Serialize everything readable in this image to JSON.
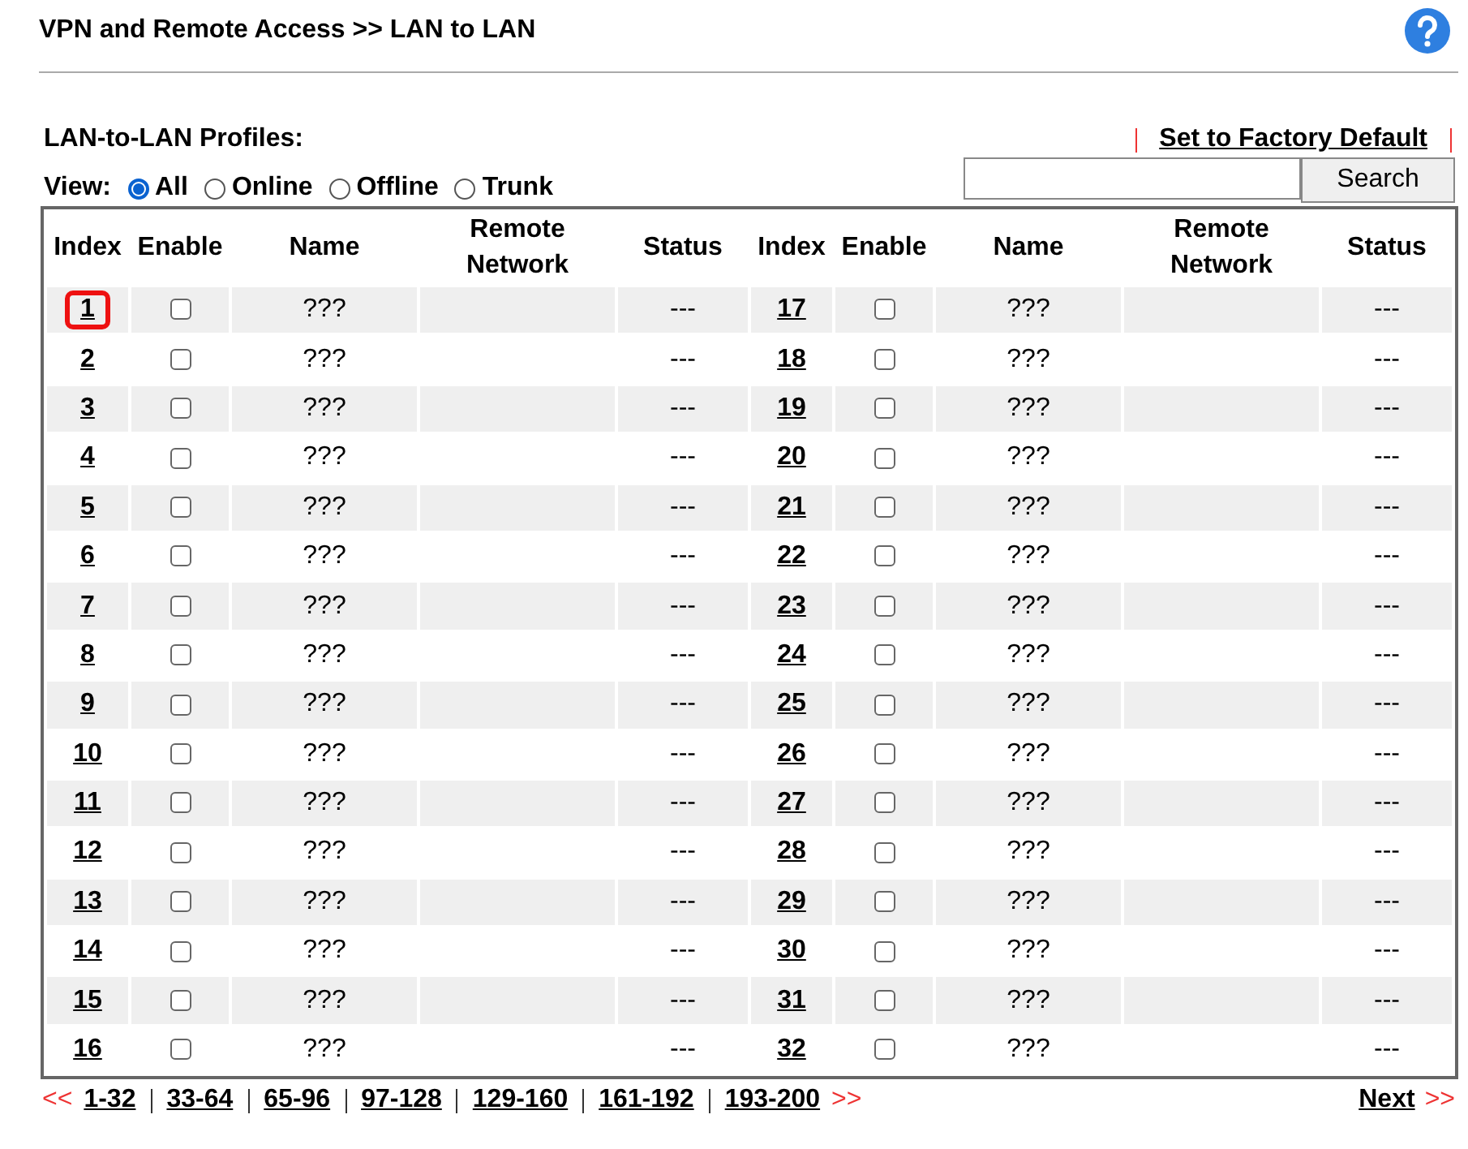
{
  "title": "VPN and Remote Access >> LAN to LAN",
  "section_title": "LAN-to-LAN Profiles:",
  "factory_default_link": "Set to Factory Default",
  "view": {
    "label": "View:",
    "options": [
      {
        "label": "All",
        "selected": true
      },
      {
        "label": "Online",
        "selected": false
      },
      {
        "label": "Offline",
        "selected": false
      },
      {
        "label": "Trunk",
        "selected": false
      }
    ]
  },
  "search": {
    "button": "Search"
  },
  "columns": [
    "Index",
    "Enable",
    "Name",
    "Remote Network",
    "Status",
    "Index",
    "Enable",
    "Name",
    "Remote Network",
    "Status"
  ],
  "profiles": [
    {
      "index": "1",
      "enabled": false,
      "name": "???",
      "status": "---",
      "highlighted": true
    },
    {
      "index": "2",
      "enabled": false,
      "name": "???",
      "status": "---",
      "highlighted": false
    },
    {
      "index": "3",
      "enabled": false,
      "name": "???",
      "status": "---",
      "highlighted": false
    },
    {
      "index": "4",
      "enabled": false,
      "name": "???",
      "status": "---",
      "highlighted": false
    },
    {
      "index": "5",
      "enabled": false,
      "name": "???",
      "status": "---",
      "highlighted": false
    },
    {
      "index": "6",
      "enabled": false,
      "name": "???",
      "status": "---",
      "highlighted": false
    },
    {
      "index": "7",
      "enabled": false,
      "name": "???",
      "status": "---",
      "highlighted": false
    },
    {
      "index": "8",
      "enabled": false,
      "name": "???",
      "status": "---",
      "highlighted": false
    },
    {
      "index": "9",
      "enabled": false,
      "name": "???",
      "status": "---",
      "highlighted": false
    },
    {
      "index": "10",
      "enabled": false,
      "name": "???",
      "status": "---",
      "highlighted": false
    },
    {
      "index": "11",
      "enabled": false,
      "name": "???",
      "status": "---",
      "highlighted": false
    },
    {
      "index": "12",
      "enabled": false,
      "name": "???",
      "status": "---",
      "highlighted": false
    },
    {
      "index": "13",
      "enabled": false,
      "name": "???",
      "status": "---",
      "highlighted": false
    },
    {
      "index": "14",
      "enabled": false,
      "name": "???",
      "status": "---",
      "highlighted": false
    },
    {
      "index": "15",
      "enabled": false,
      "name": "???",
      "status": "---",
      "highlighted": false
    },
    {
      "index": "16",
      "enabled": false,
      "name": "???",
      "status": "---",
      "highlighted": false
    },
    {
      "index": "17",
      "enabled": false,
      "name": "???",
      "status": "---",
      "highlighted": false
    },
    {
      "index": "18",
      "enabled": false,
      "name": "???",
      "status": "---",
      "highlighted": false
    },
    {
      "index": "19",
      "enabled": false,
      "name": "???",
      "status": "---",
      "highlighted": false
    },
    {
      "index": "20",
      "enabled": false,
      "name": "???",
      "status": "---",
      "highlighted": false
    },
    {
      "index": "21",
      "enabled": false,
      "name": "???",
      "status": "---",
      "highlighted": false
    },
    {
      "index": "22",
      "enabled": false,
      "name": "???",
      "status": "---",
      "highlighted": false
    },
    {
      "index": "23",
      "enabled": false,
      "name": "???",
      "status": "---",
      "highlighted": false
    },
    {
      "index": "24",
      "enabled": false,
      "name": "???",
      "status": "---",
      "highlighted": false
    },
    {
      "index": "25",
      "enabled": false,
      "name": "???",
      "status": "---",
      "highlighted": false
    },
    {
      "index": "26",
      "enabled": false,
      "name": "???",
      "status": "---",
      "highlighted": false
    },
    {
      "index": "27",
      "enabled": false,
      "name": "???",
      "status": "---",
      "highlighted": false
    },
    {
      "index": "28",
      "enabled": false,
      "name": "???",
      "status": "---",
      "highlighted": false
    },
    {
      "index": "29",
      "enabled": false,
      "name": "???",
      "status": "---",
      "highlighted": false
    },
    {
      "index": "30",
      "enabled": false,
      "name": "???",
      "status": "---",
      "highlighted": false
    },
    {
      "index": "31",
      "enabled": false,
      "name": "???",
      "status": "---",
      "highlighted": false
    },
    {
      "index": "32",
      "enabled": false,
      "name": "???",
      "status": "---",
      "highlighted": false
    }
  ],
  "pagination": {
    "prev": "<<",
    "pages": [
      "1-32",
      "33-64",
      "65-96",
      "97-128",
      "129-160",
      "161-192",
      "193-200"
    ],
    "next_arrows": ">>",
    "next_label": "Next",
    "next_suffix": ">>"
  }
}
